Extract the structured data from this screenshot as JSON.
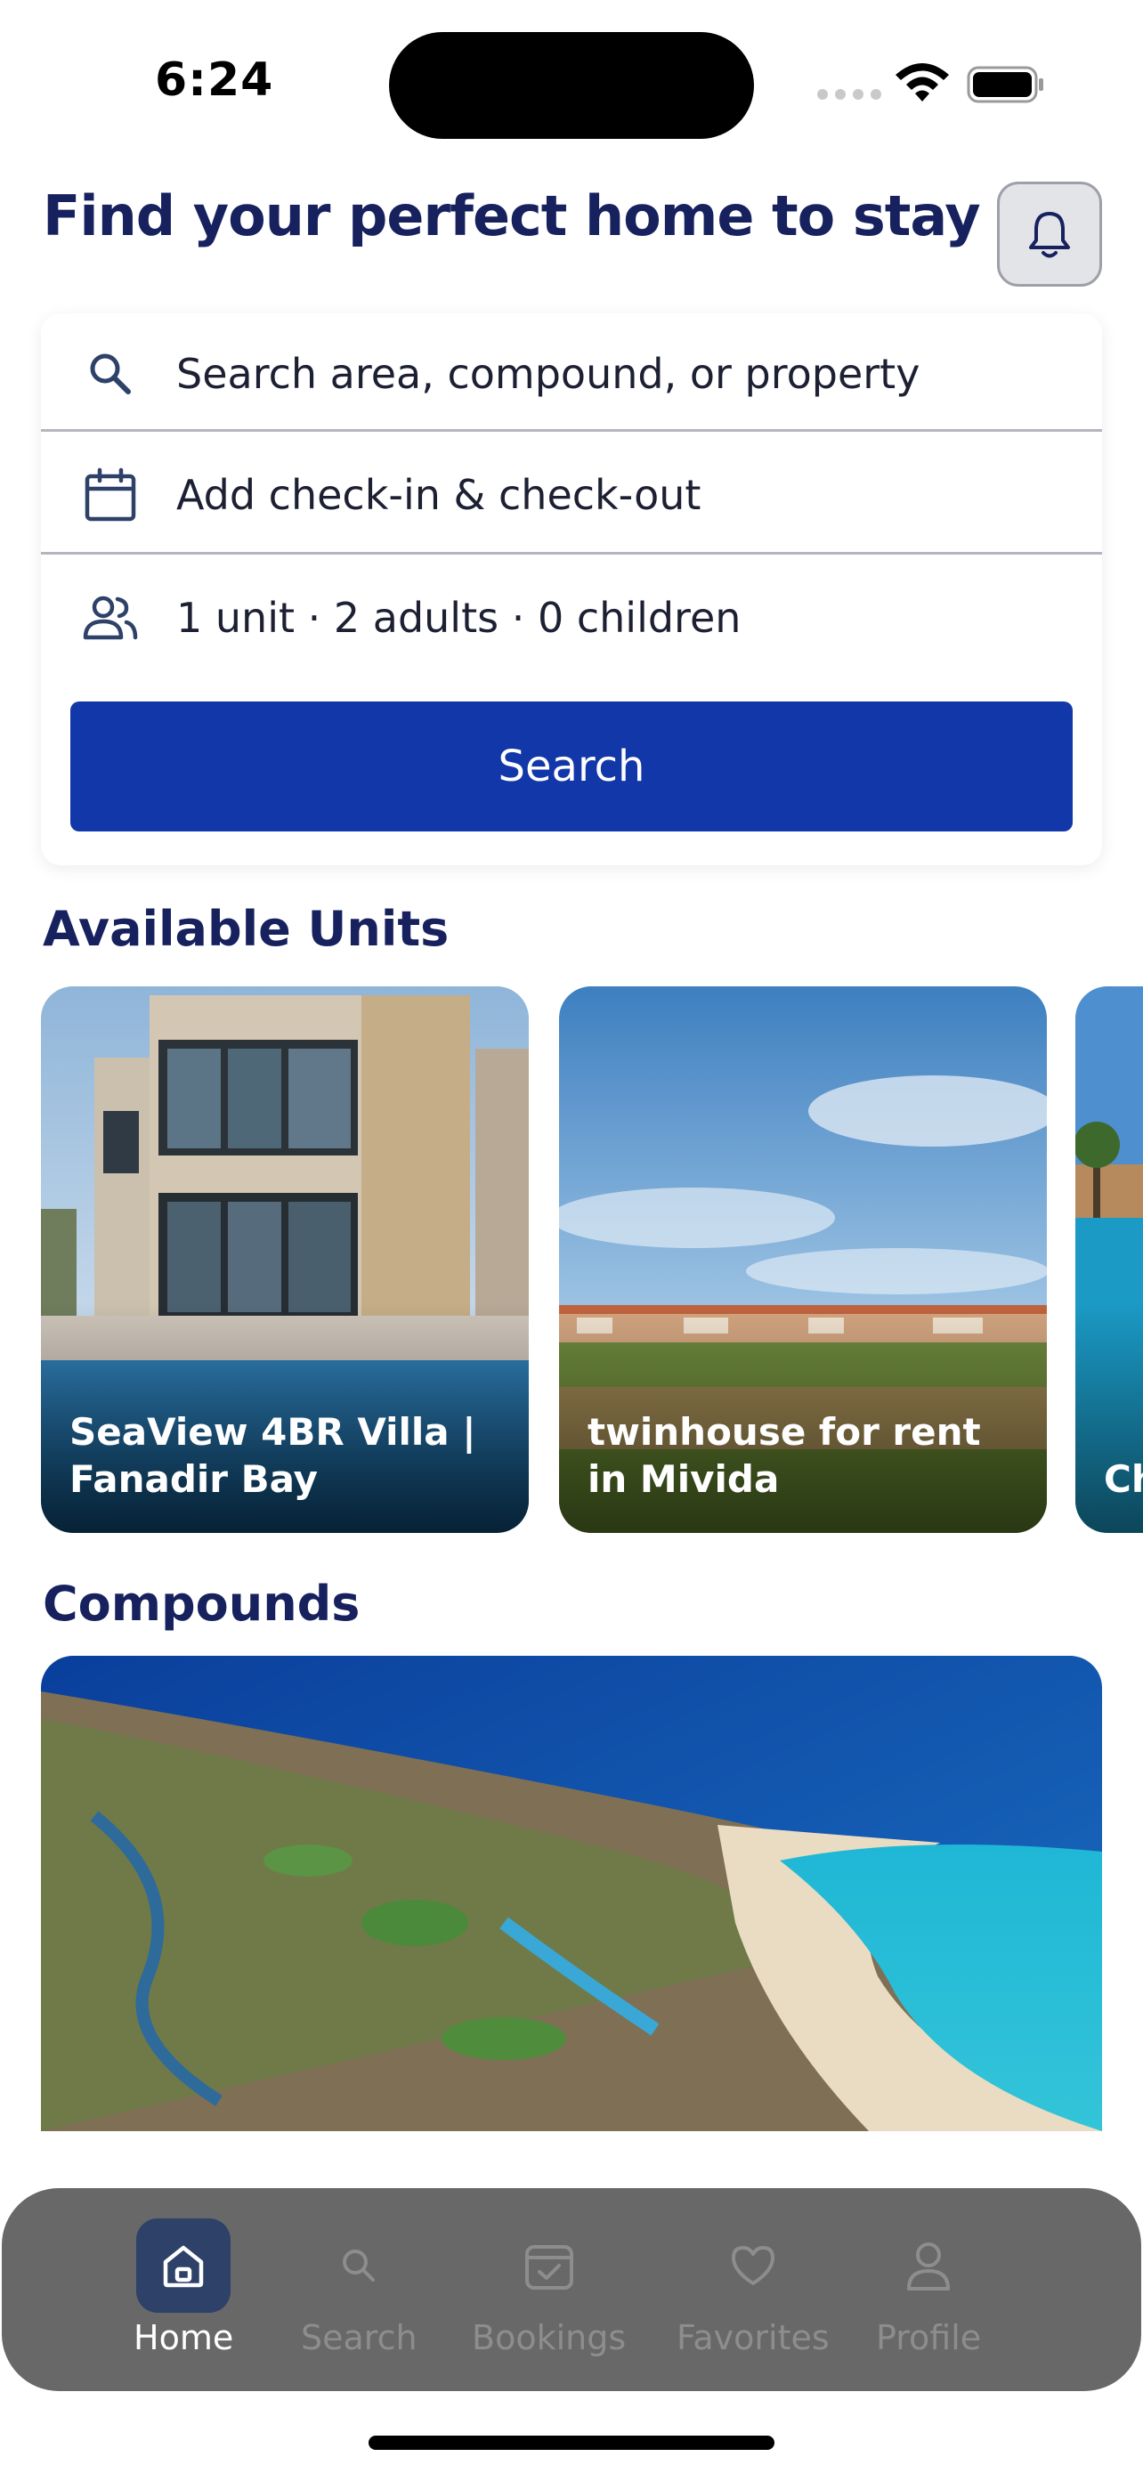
{
  "status_bar": {
    "time": "6:24"
  },
  "header": {
    "title": "Find your perfect home to stay"
  },
  "search": {
    "location_placeholder": "Search area, compound, or property",
    "dates_placeholder": "Add check-in & check-out",
    "guests_summary": "1 unit · 2 adults · 0 children",
    "button_label": "Search"
  },
  "available_units": {
    "title": "Available Units",
    "items": [
      {
        "title": "SeaView 4BR Villa | Fanadir Bay"
      },
      {
        "title": "twinhouse for rent in Mivida"
      },
      {
        "title": "Ch re"
      }
    ]
  },
  "compounds": {
    "title": "Compounds"
  },
  "tab_bar": {
    "tabs": [
      {
        "label": "Home",
        "icon": "home-icon",
        "active": true
      },
      {
        "label": "Search",
        "icon": "search-icon",
        "active": false
      },
      {
        "label": "Bookings",
        "icon": "calendar-check-icon",
        "active": false
      },
      {
        "label": "Favorites",
        "icon": "heart-icon",
        "active": false
      },
      {
        "label": "Profile",
        "icon": "person-icon",
        "active": false
      }
    ]
  },
  "colors": {
    "primary": "#1237a8",
    "title": "#16215e",
    "tab_bar": "#686868",
    "tab_active": "#2e4168"
  }
}
